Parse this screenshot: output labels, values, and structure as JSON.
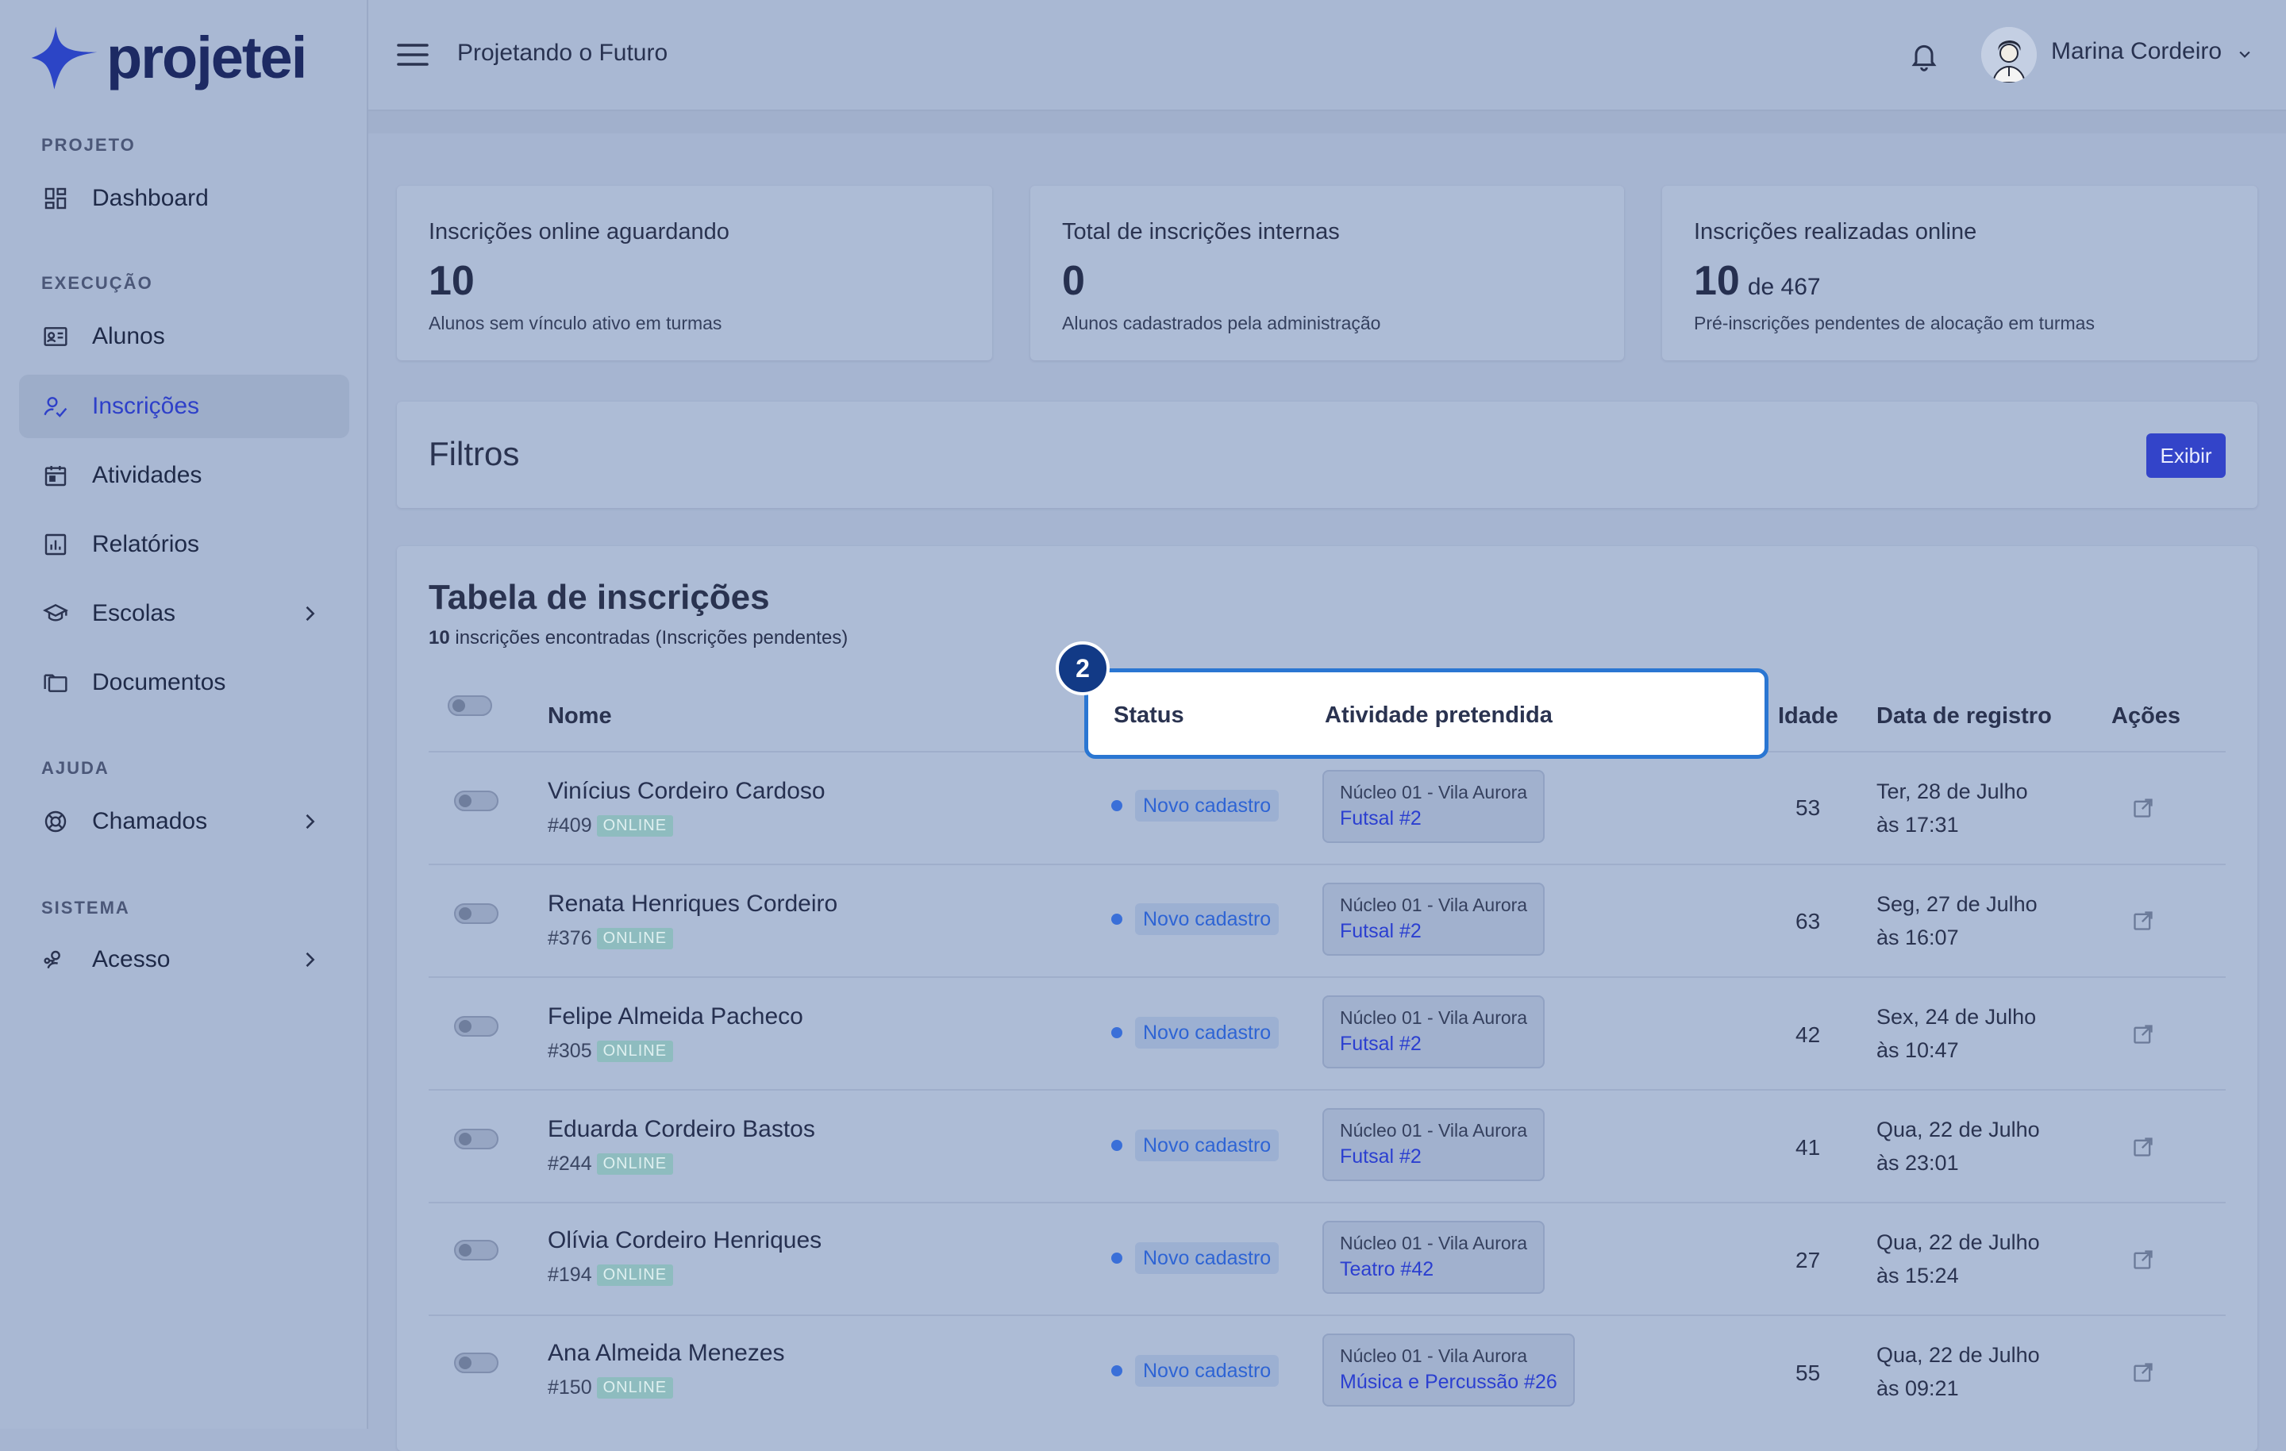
{
  "brand": {
    "name": "projetei"
  },
  "sidebar": {
    "sections": [
      {
        "label": "PROJETO"
      },
      {
        "label": "EXECUÇÃO"
      },
      {
        "label": "AJUDA"
      },
      {
        "label": "SISTEMA"
      }
    ],
    "items": [
      {
        "label": "Dashboard",
        "icon": "dashboard-icon"
      },
      {
        "label": "Alunos",
        "icon": "id-card-icon"
      },
      {
        "label": "Inscrições",
        "icon": "user-check-icon",
        "active": true
      },
      {
        "label": "Atividades",
        "icon": "calendar-icon"
      },
      {
        "label": "Relatórios",
        "icon": "bar-chart-icon"
      },
      {
        "label": "Escolas",
        "icon": "graduation-cap-icon"
      },
      {
        "label": "Documentos",
        "icon": "folders-icon"
      },
      {
        "label": "Chamados",
        "icon": "lifebuoy-icon"
      },
      {
        "label": "Acesso",
        "icon": "user-key-icon"
      }
    ]
  },
  "header": {
    "project_title": "Projetando o Futuro",
    "user_name": "Marina Cordeiro"
  },
  "stats": [
    {
      "title": "Inscrições online aguardando",
      "value": "10",
      "of": "",
      "subtitle": "Alunos sem vínculo ativo em turmas"
    },
    {
      "title": "Total de inscrições internas",
      "value": "0",
      "of": "",
      "subtitle": "Alunos cadastrados pela administração"
    },
    {
      "title": "Inscrições realizadas online",
      "value": "10",
      "of": "de 467",
      "subtitle": "Pré-inscrições pendentes de alocação em turmas"
    }
  ],
  "filters": {
    "title": "Filtros",
    "button_label": "Exibir"
  },
  "table": {
    "title": "Tabela de inscrições",
    "count": "10",
    "count_suffix": "inscrições encontradas (Inscrições pendentes)",
    "columns": {
      "name": "Nome",
      "status": "Status",
      "activity": "Atividade pretendida",
      "age": "Idade",
      "date": "Data de registro",
      "actions": "Ações"
    },
    "badge_label": "ONLINE",
    "rows": [
      {
        "name": "Vinícius Cordeiro Cardoso",
        "id": "#409",
        "status": "Novo cadastro",
        "location": "Núcleo 01 - Vila Aurora",
        "activity": "Futsal #2",
        "age": "53",
        "date1": "Ter, 28 de Julho",
        "date2": "às 17:31"
      },
      {
        "name": "Renata Henriques Cordeiro",
        "id": "#376",
        "status": "Novo cadastro",
        "location": "Núcleo 01 - Vila Aurora",
        "activity": "Futsal #2",
        "age": "63",
        "date1": "Seg, 27 de Julho",
        "date2": "às 16:07"
      },
      {
        "name": "Felipe Almeida Pacheco",
        "id": "#305",
        "status": "Novo cadastro",
        "location": "Núcleo 01 - Vila Aurora",
        "activity": "Futsal #2",
        "age": "42",
        "date1": "Sex, 24 de Julho",
        "date2": "às 10:47"
      },
      {
        "name": "Eduarda Cordeiro Bastos",
        "id": "#244",
        "status": "Novo cadastro",
        "location": "Núcleo 01 - Vila Aurora",
        "activity": "Futsal #2",
        "age": "41",
        "date1": "Qua, 22 de Julho",
        "date2": "às 23:01"
      },
      {
        "name": "Olívia Cordeiro Henriques",
        "id": "#194",
        "status": "Novo cadastro",
        "location": "Núcleo 01 - Vila Aurora",
        "activity": "Teatro #42",
        "age": "27",
        "date1": "Qua, 22 de Julho",
        "date2": "às 15:24"
      },
      {
        "name": "Ana Almeida Menezes",
        "id": "#150",
        "status": "Novo cadastro",
        "location": "Núcleo 01 - Vila Aurora",
        "activity": "Música e Percussão #26",
        "age": "55",
        "date1": "Qua, 22 de Julho",
        "date2": "às 09:21"
      }
    ]
  },
  "highlight": {
    "step": "2",
    "status_label": "Status",
    "activity_label": "Atividade pretendida"
  },
  "colors": {
    "accent": "#3344c9",
    "highlight_border": "#2a76d2",
    "step_badge": "#123a86",
    "status_blue": "#2e64d4"
  }
}
